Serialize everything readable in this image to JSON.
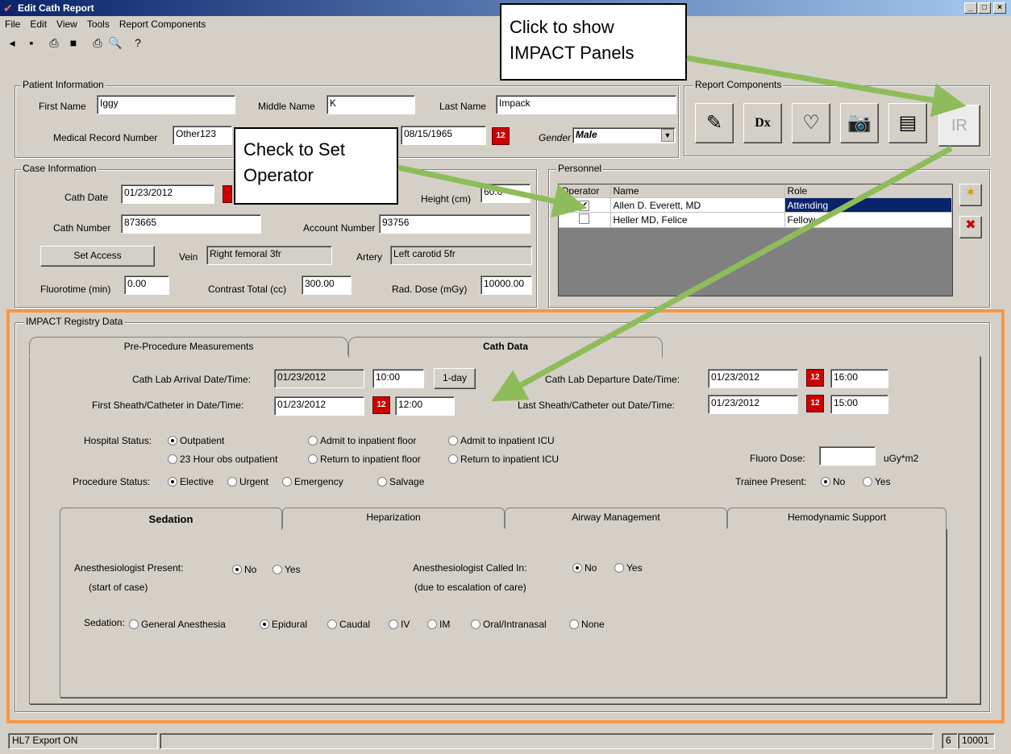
{
  "window": {
    "title": "Edit Cath Report"
  },
  "menu": [
    "File",
    "Edit",
    "View",
    "Tools",
    "Report Components"
  ],
  "patient": {
    "group": "Patient Information",
    "first_label": "First Name",
    "first": "Iggy",
    "middle_label": "Middle Name",
    "middle": "K",
    "last_label": "Last Name",
    "last": "Impack",
    "mrn_label": "Medical Record Number",
    "mrn": "Other123",
    "dob": "08/15/1965",
    "gender_label": "Gender",
    "gender": "Male"
  },
  "components": {
    "group": "Report Components",
    "dx": "Dx",
    "ir": "IR"
  },
  "case": {
    "group": "Case Information",
    "cath_date_label": "Cath Date",
    "cath_date": "01/23/2012",
    "height_label": "Height (cm)",
    "height": "60.0",
    "cath_num_label": "Cath Number",
    "cath_num": "873665",
    "account_label": "Account Number",
    "account": "93756",
    "set_access": "Set Access",
    "vein_label": "Vein",
    "vein": "Right femoral 3fr",
    "artery_label": "Artery",
    "artery": "Left carotid 5fr",
    "fluoro_label": "Fluorotime (min)",
    "fluoro": "0.00",
    "contrast_label": "Contrast Total (cc)",
    "contrast": "300.00",
    "rad_label": "Rad. Dose (mGy)",
    "rad": "10000.00"
  },
  "personnel": {
    "group": "Personnel",
    "headers": [
      "Operator",
      "Name",
      "Role"
    ],
    "rows": [
      {
        "name": "Allen D. Everett, MD",
        "role": "Attending",
        "operator": true
      },
      {
        "name": "Heller MD, Felice",
        "role": "Fellow",
        "operator": false
      }
    ]
  },
  "callouts": {
    "impact": "Click to show IMPACT Panels",
    "operator": "Check to Set Operator"
  },
  "impact": {
    "group": "IMPACT Registry Data",
    "tabs": [
      "Pre-Procedure Measurements",
      "Cath Data"
    ],
    "arrival_label": "Cath Lab Arrival Date/Time:",
    "arrival_date": "01/23/2012",
    "arrival_time": "10:00",
    "oneday": "1-day",
    "departure_label": "Cath Lab Departure Date/Time:",
    "departure_date": "01/23/2012",
    "departure_time": "16:00",
    "sheath_in_label": "First Sheath/Catheter in Date/Time:",
    "sheath_in_date": "01/23/2012",
    "sheath_in_time": "12:00",
    "sheath_out_label": "Last Sheath/Catheter out Date/Time:",
    "sheath_out_date": "01/23/2012",
    "sheath_out_time": "15:00",
    "hospital_label": "Hospital Status:",
    "hospital_opts": [
      "Outpatient",
      "Admit to inpatient floor",
      "Admit to inpatient ICU",
      "23 Hour obs outpatient",
      "Return to inpatient floor",
      "Return to inpatient ICU"
    ],
    "fluoro_dose_label": "Fluoro Dose:",
    "fluoro_dose_unit": "uGy*m2",
    "proc_label": "Procedure Status:",
    "proc_opts": [
      "Elective",
      "Urgent",
      "Emergency",
      "Salvage"
    ],
    "trainee_label": "Trainee Present:",
    "no": "No",
    "yes": "Yes",
    "subtabs": [
      "Sedation",
      "Heparization",
      "Airway Management",
      "Hemodynamic Support"
    ],
    "anes_present_label": "Anesthesiologist Present:",
    "anes_present_sub": "(start of case)",
    "anes_called_label": "Anesthesiologist Called In:",
    "anes_called_sub": "(due to escalation of care)",
    "sedation_label": "Sedation:",
    "sedation_opts": [
      "General Anesthesia",
      "Epidural",
      "Caudal",
      "IV",
      "IM",
      "Oral/Intranasal",
      "None"
    ]
  },
  "status": {
    "hl7": "HL7 Export ON",
    "page": "6",
    "code": "10001"
  }
}
